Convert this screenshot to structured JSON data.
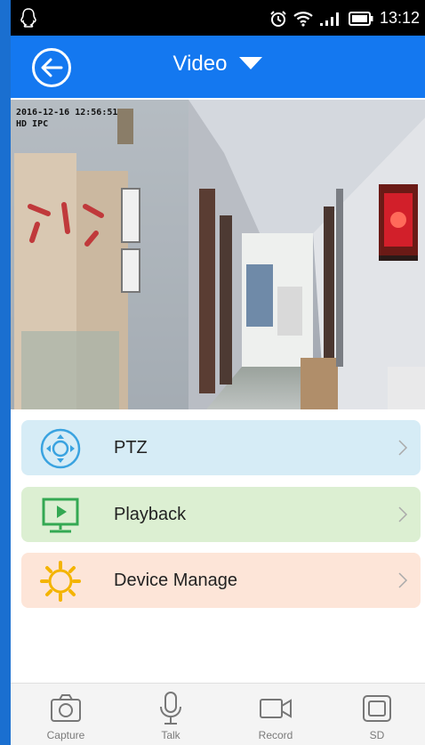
{
  "status_bar": {
    "time": "13:12",
    "icons": [
      "qq-icon",
      "alarm-icon",
      "wifi-icon",
      "signal-icon",
      "battery-icon"
    ]
  },
  "app_bar": {
    "title": "Video",
    "back_icon": "back-arrow-icon",
    "dropdown_icon": "caret-down-icon",
    "color": "#1478f0"
  },
  "video": {
    "timestamp": "2016-12-16 12:56:51",
    "channel": "HD IPC"
  },
  "menu": {
    "items": [
      {
        "label": "PTZ",
        "icon": "ptz-icon",
        "bg": "#d6ecf6"
      },
      {
        "label": "Playback",
        "icon": "playback-monitor-icon",
        "bg": "#dcefd2"
      },
      {
        "label": "Device Manage",
        "icon": "gear-icon",
        "bg": "#fde5d8"
      }
    ]
  },
  "bottom_bar": {
    "tabs": [
      {
        "label": "Capture",
        "icon": "camera-icon"
      },
      {
        "label": "Talk",
        "icon": "microphone-icon"
      },
      {
        "label": "Record",
        "icon": "video-camera-icon"
      },
      {
        "label": "SD",
        "icon": "sd-card-icon"
      }
    ]
  }
}
